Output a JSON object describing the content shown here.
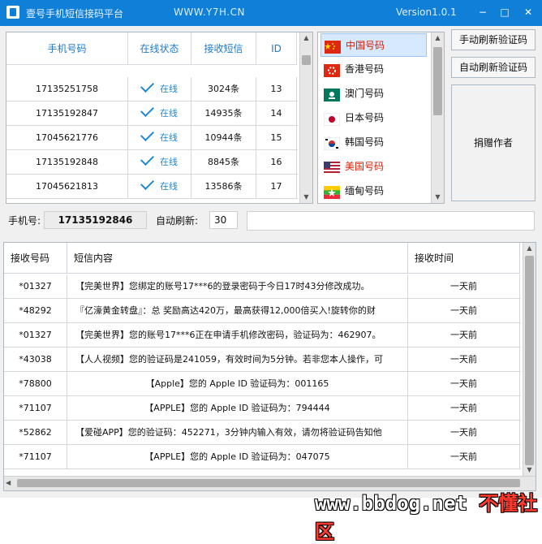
{
  "window": {
    "title": "壹号手机短信接码平台",
    "url_text": "WWW.Y7H.CN",
    "version": "Version1.0.1",
    "minimize_glyph": "−",
    "maximize_glyph": "□",
    "close_glyph": "✕"
  },
  "numbers_table": {
    "headers": {
      "phone": "手机号码",
      "status": "在线状态",
      "sms": "接收短信",
      "id": "ID"
    },
    "rows": [
      {
        "phone": "17135251758",
        "status": "在线",
        "sms": "3024条",
        "id": "13"
      },
      {
        "phone": "17135192847",
        "status": "在线",
        "sms": "14935条",
        "id": "14"
      },
      {
        "phone": "17045621776",
        "status": "在线",
        "sms": "10944条",
        "id": "15"
      },
      {
        "phone": "17135192848",
        "status": "在线",
        "sms": "8845条",
        "id": "16"
      },
      {
        "phone": "17045621813",
        "status": "在线",
        "sms": "13586条",
        "id": "17"
      }
    ]
  },
  "countries": {
    "items": [
      {
        "label": "中国号码",
        "selected": true,
        "flag": "cn-flag-icon"
      },
      {
        "label": "香港号码",
        "selected": false,
        "flag": "hk-flag-icon"
      },
      {
        "label": "澳门号码",
        "selected": false,
        "flag": "mo-flag-icon"
      },
      {
        "label": "日本号码",
        "selected": false,
        "flag": "jp-flag-icon"
      },
      {
        "label": "韩国号码",
        "selected": false,
        "flag": "kr-flag-icon"
      },
      {
        "label": "美国号码",
        "selected": false,
        "flag": "us-flag-icon"
      },
      {
        "label": "缅甸号码",
        "selected": false,
        "flag": "mm-flag-icon"
      }
    ]
  },
  "buttons": {
    "manual_refresh": "手动刷新验证码",
    "auto_refresh": "自动刷新验证码",
    "donate": "捐赠作者"
  },
  "controls": {
    "phone_label": "手机号:",
    "phone_value": "17135192846",
    "auto_refresh_label": "自动刷新:",
    "auto_refresh_value": "30",
    "extra_field_value": ""
  },
  "messages_table": {
    "headers": {
      "sender": "接收号码",
      "content": "短信内容",
      "time": "接收时间"
    },
    "rows": [
      {
        "sender": "*01327",
        "content": "【完美世界】您绑定的账号17***6的登录密码于今日17时43分修改成功。",
        "time": "一天前"
      },
      {
        "sender": "*48292",
        "content": "『亿濠黄金转盘』：总  奖励高达420万，最高获得12,000倍买入!旋转你的财",
        "time": "一天前"
      },
      {
        "sender": "*01327",
        "content": "【完美世界】您的账号17***6正在申请手机修改密码，验证码为：462907。",
        "time": "一天前"
      },
      {
        "sender": "*43038",
        "content": "【人人视频】您的验证码是241059，有效时间为5分钟。若非您本人操作，可",
        "time": "一天前"
      },
      {
        "sender": "*78800",
        "content": "【Apple】您的 Apple ID 验证码为：001165",
        "time": "一天前"
      },
      {
        "sender": "*71107",
        "content": "【APPLE】您的 Apple ID 验证码为：794444",
        "time": "一天前"
      },
      {
        "sender": "*52862",
        "content": "【爱碰APP】您的验证码：452271，3分钟内输入有效，请勿将验证码告知他",
        "time": "一天前"
      },
      {
        "sender": "*71107",
        "content": "【APPLE】您的 Apple ID 验证码为：047075",
        "time": "一天前"
      }
    ]
  },
  "watermark": {
    "site": "www.bbdog.net",
    "name": "不懂社区"
  },
  "colors": {
    "titlebar": "#0f7fd8",
    "header_text": "#1e7ac8",
    "red_label": "#d81e06",
    "watermark_white": "#ffffff",
    "watermark_red": "#ff3b30"
  }
}
